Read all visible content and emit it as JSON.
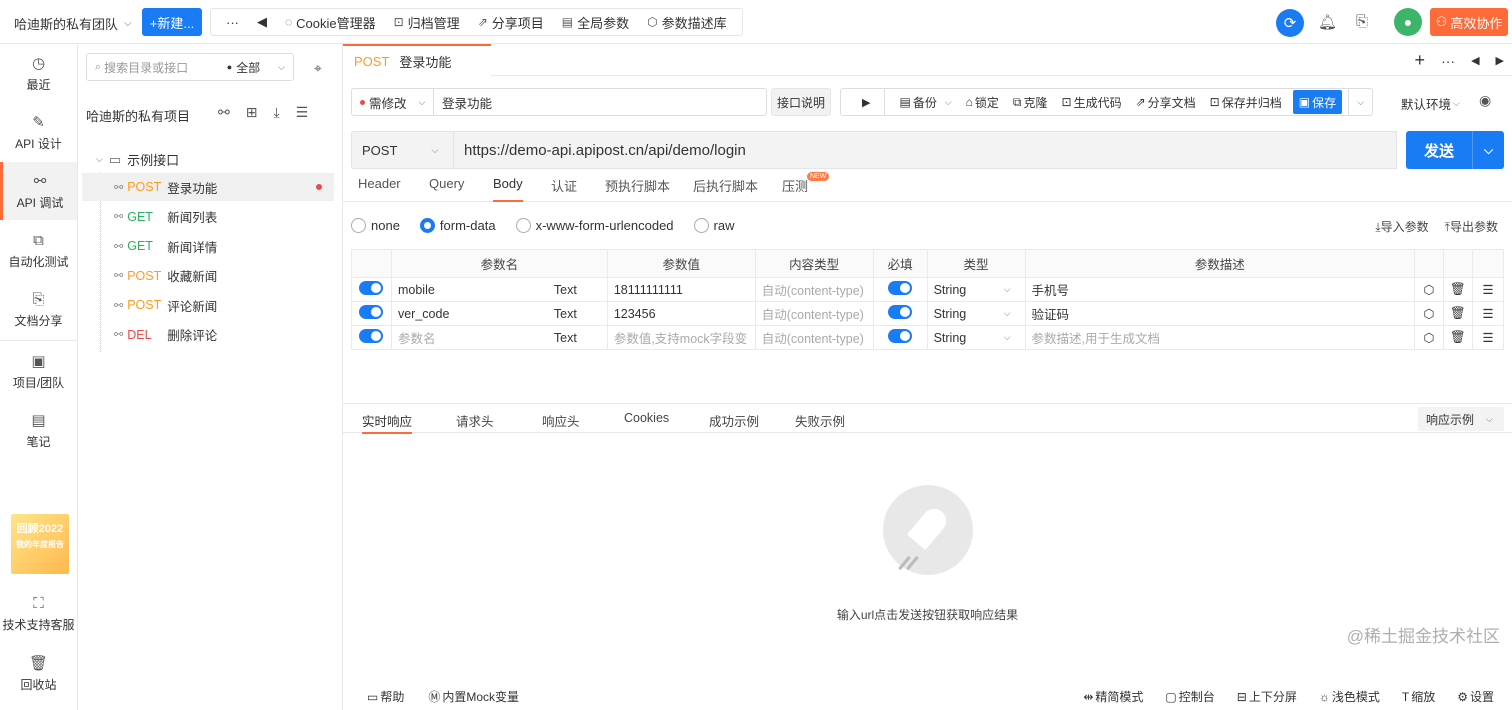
{
  "topbar": {
    "team": "哈迪斯的私有团队",
    "new_button": "+新建...",
    "more": "···",
    "back": "◀",
    "nav": [
      {
        "icon": "cookie-icon",
        "glyph": "◌",
        "label": "Cookie管理器"
      },
      {
        "icon": "archive-icon",
        "glyph": "⊡",
        "label": "归档管理"
      },
      {
        "icon": "share-icon",
        "glyph": "⇗",
        "label": "分享项目"
      },
      {
        "icon": "global-params-icon",
        "glyph": "▤",
        "label": "全局参数"
      },
      {
        "icon": "cube-icon",
        "glyph": "⬡",
        "label": "参数描述库"
      }
    ],
    "collab_button": "高效协作"
  },
  "rail": {
    "items": [
      {
        "name": "recent",
        "glyph": "◷",
        "label": "最近"
      },
      {
        "name": "api-design",
        "glyph": "✎",
        "label": "API 设计"
      },
      {
        "name": "api-debug",
        "glyph": "⚯",
        "label": "API 调试"
      },
      {
        "name": "auto-test",
        "glyph": "⧉",
        "label": "自动化测试"
      },
      {
        "name": "doc-share",
        "glyph": "⎘",
        "label": "文档分享"
      },
      {
        "name": "project-team",
        "glyph": "▣",
        "label": "项目/团队"
      },
      {
        "name": "notes",
        "glyph": "▤",
        "label": "笔记"
      },
      {
        "name": "support",
        "glyph": "⛶",
        "label": "技术支持客服"
      },
      {
        "name": "recycle",
        "glyph": "🗑",
        "label": "回收站"
      }
    ],
    "promo_title": "回顾2022",
    "promo_sub": "我的年度报告"
  },
  "tree": {
    "search_placeholder": "搜索目录或接口",
    "filter": "全部",
    "project_title": "哈迪斯的私有项目",
    "folder": "示例接口",
    "apis": [
      {
        "method": "POST",
        "color": "#ff9a1f",
        "name": "登录功能",
        "selected": true
      },
      {
        "method": "GET",
        "color": "#27b35d",
        "name": "新闻列表"
      },
      {
        "method": "GET",
        "color": "#27b35d",
        "name": "新闻详情"
      },
      {
        "method": "POST",
        "color": "#ff9a1f",
        "name": "收藏新闻"
      },
      {
        "method": "POST",
        "color": "#ff9a1f",
        "name": "评论新闻"
      },
      {
        "method": "DEL",
        "color": "#f04848",
        "name": "删除评论"
      }
    ]
  },
  "main": {
    "open_tab": {
      "method": "POST",
      "title": "登录功能"
    },
    "status": "需修改",
    "api_name": "登录功能",
    "doc_button": "接口说明",
    "toolbar": {
      "backup": "备份",
      "lock": "锁定",
      "clone": "克隆",
      "gen_code": "生成代码",
      "share_doc": "分享文档",
      "save_archive": "保存并归档",
      "save": "保存"
    },
    "env": "默认环境",
    "method": "POST",
    "url": "https://demo-api.apipost.cn/api/demo/login",
    "send": "发送",
    "req_tabs": [
      "Header",
      "Query",
      "Body",
      "认证",
      "预执行脚本",
      "后执行脚本",
      "压测"
    ],
    "new_badge": "NEW",
    "body_modes": [
      "none",
      "form-data",
      "x-www-form-urlencoded",
      "raw"
    ],
    "import_params": "导入参数",
    "export_params": "导出参数",
    "table": {
      "headers": [
        "参数名",
        "参数值",
        "内容类型",
        "必填",
        "类型",
        "参数描述"
      ],
      "rows": [
        {
          "name": "mobile",
          "ftype": "Text",
          "value": "18111111111",
          "ctype": "自动(content-type)",
          "type": "String",
          "desc": "手机号",
          "placeholder": false
        },
        {
          "name": "ver_code",
          "ftype": "Text",
          "value": "123456",
          "ctype": "自动(content-type)",
          "type": "String",
          "desc": "验证码",
          "placeholder": false
        },
        {
          "name": "参数名",
          "ftype": "Text",
          "value": "参数值,支持mock字段变",
          "ctype": "自动(content-type)",
          "type": "String",
          "desc": "参数描述,用于生成文档",
          "placeholder": true
        }
      ]
    },
    "resp_tabs": [
      "实时响应",
      "请求头",
      "响应头",
      "Cookies",
      "成功示例",
      "失败示例"
    ],
    "resp_example": "响应示例",
    "empty_text": "输入url点击发送按钮获取响应结果",
    "footer_left": [
      {
        "glyph": "▭",
        "label": "帮助"
      },
      {
        "glyph": "Ⓜ",
        "label": "内置Mock变量"
      }
    ],
    "footer_right": [
      {
        "glyph": "⇹",
        "label": "精简模式"
      },
      {
        "glyph": "▢",
        "label": "控制台"
      },
      {
        "glyph": "⊟",
        "label": "上下分屏"
      },
      {
        "glyph": "☼",
        "label": "浅色模式"
      },
      {
        "glyph": "T",
        "label": "缩放"
      },
      {
        "glyph": "⚙",
        "label": "设置"
      }
    ],
    "watermark": "@稀土掘金技术社区"
  }
}
